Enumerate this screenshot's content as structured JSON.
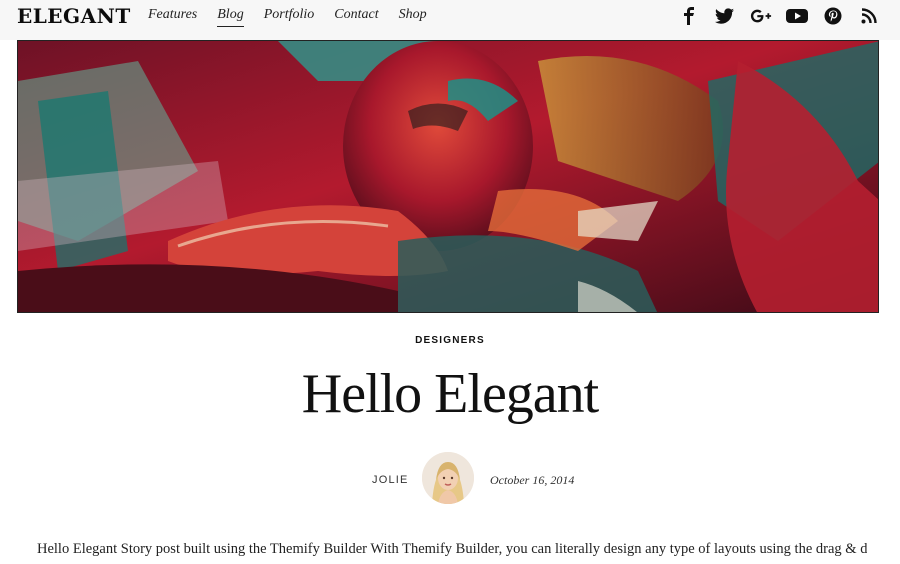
{
  "site": {
    "logo": "ELEGANT"
  },
  "nav": {
    "items": [
      {
        "label": "Features"
      },
      {
        "label": "Blog"
      },
      {
        "label": "Portfolio"
      },
      {
        "label": "Contact"
      },
      {
        "label": "Shop"
      }
    ],
    "active": "Blog"
  },
  "social": [
    "facebook-icon",
    "twitter-icon",
    "google-plus-icon",
    "youtube-icon",
    "pinterest-icon",
    "rss-icon"
  ],
  "post": {
    "category": "DESIGNERS",
    "title": "Hello Elegant",
    "author": "JOLIE",
    "date": "October 16, 2014",
    "excerpt": "Hello Elegant Story post built using the Themify Builder With Themify Builder, you can literally design any type of layouts using the drag & drop"
  },
  "colors": {
    "accent": "#111111",
    "topbar": "#f7f7f7"
  }
}
